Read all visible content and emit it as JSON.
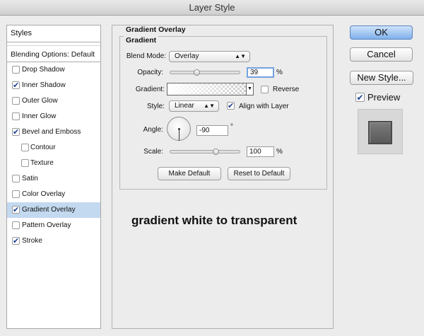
{
  "window": {
    "title": "Layer Style"
  },
  "sidebar": {
    "header": "Styles",
    "blending": "Blending Options: Default",
    "items": [
      {
        "label": "Drop Shadow",
        "checked": false,
        "indent": false,
        "selected": false
      },
      {
        "label": "Inner Shadow",
        "checked": true,
        "indent": false,
        "selected": false
      },
      {
        "label": "Outer Glow",
        "checked": false,
        "indent": false,
        "selected": false
      },
      {
        "label": "Inner Glow",
        "checked": false,
        "indent": false,
        "selected": false
      },
      {
        "label": "Bevel and Emboss",
        "checked": true,
        "indent": false,
        "selected": false
      },
      {
        "label": "Contour",
        "checked": false,
        "indent": true,
        "selected": false
      },
      {
        "label": "Texture",
        "checked": false,
        "indent": true,
        "selected": false
      },
      {
        "label": "Satin",
        "checked": false,
        "indent": false,
        "selected": false
      },
      {
        "label": "Color Overlay",
        "checked": false,
        "indent": false,
        "selected": false
      },
      {
        "label": "Gradient Overlay",
        "checked": true,
        "indent": false,
        "selected": true
      },
      {
        "label": "Pattern Overlay",
        "checked": false,
        "indent": false,
        "selected": false
      },
      {
        "label": "Stroke",
        "checked": true,
        "indent": false,
        "selected": false
      }
    ]
  },
  "panel": {
    "title": "Gradient Overlay",
    "group_title": "Gradient",
    "blend_mode": {
      "label": "Blend Mode:",
      "value": "Overlay"
    },
    "opacity": {
      "label": "Opacity:",
      "value": "39",
      "unit": "%",
      "level": 39
    },
    "gradient": {
      "label": "Gradient:",
      "reverse_label": "Reverse",
      "reverse_checked": false
    },
    "style": {
      "label": "Style:",
      "value": "Linear",
      "align_label": "Align with Layer",
      "align_checked": true
    },
    "angle": {
      "label": "Angle:",
      "value": "-90",
      "unit": "°"
    },
    "scale": {
      "label": "Scale:",
      "value": "100",
      "unit": "%",
      "level": 100
    },
    "make_default": "Make Default",
    "reset_default": "Reset to Default",
    "note": "gradient white to transparent"
  },
  "buttons": {
    "ok": "OK",
    "cancel": "Cancel",
    "new_style": "New Style...",
    "preview_label": "Preview",
    "preview_checked": true
  },
  "icons": {
    "check": "checkmark-icon",
    "select_arrows": "up-down-arrows-icon",
    "dropdown": "triangle-down-icon"
  }
}
